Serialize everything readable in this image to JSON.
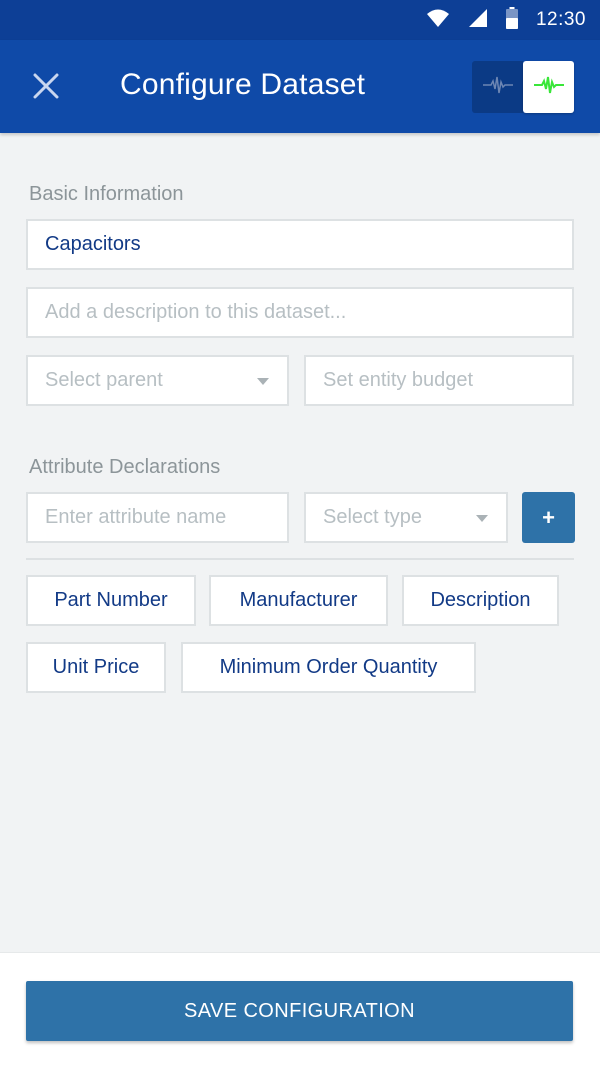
{
  "status_bar": {
    "time": "12:30",
    "icons": [
      "wifi-icon",
      "cell-signal-icon",
      "battery-icon"
    ]
  },
  "app_bar": {
    "title": "Configure Dataset",
    "close_icon": "close-icon",
    "view_toggle": {
      "options": [
        "waveform-inactive-icon",
        "waveform-active-icon"
      ],
      "active_index": 1,
      "active_color": "#39e639"
    }
  },
  "basic_info": {
    "label": "Basic Information",
    "name_value": "Capacitors",
    "description_placeholder": "Add a description to this dataset...",
    "parent_placeholder": "Select parent",
    "budget_placeholder": "Set entity budget"
  },
  "attributes": {
    "label": "Attribute Declarations",
    "name_placeholder": "Enter attribute name",
    "type_placeholder": "Select type",
    "add_label": "+",
    "chips": [
      "Part Number",
      "Manufacturer",
      "Description",
      "Unit Price",
      "Minimum Order Quantity"
    ]
  },
  "footer": {
    "save_label": "SAVE CONFIGURATION"
  },
  "colors": {
    "app_bar": "#0f4aa8",
    "status_bar": "#0d3f96",
    "accent": "#2e72a8",
    "text_primary": "#123a86"
  }
}
